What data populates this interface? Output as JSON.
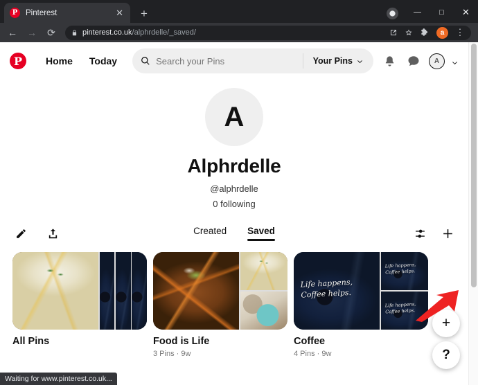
{
  "browser": {
    "tab": {
      "title": "Pinterest",
      "favicon": "pinterest-icon",
      "close": "✕"
    },
    "new_tab_label": "+",
    "window_controls": {
      "minimize": "—",
      "maximize": "□",
      "close": "✕"
    },
    "nav": {
      "back": "←",
      "forward": "→",
      "reload": "⟳"
    },
    "omnibox": {
      "lock_icon": "lock-icon",
      "url_domain": "pinterest.co.uk",
      "url_path": "/alphrdelle/_saved/",
      "install_icon": "install-icon",
      "bookmark_icon": "star-icon",
      "extensions_icon": "puzzle-icon",
      "profile_initial": "a",
      "menu_icon": "⋮"
    },
    "status_text": "Waiting for www.pinterest.co.uk..."
  },
  "header": {
    "logo": "pinterest-logo",
    "logo_letter": "P",
    "home_label": "Home",
    "today_label": "Today",
    "search_placeholder": "Search your Pins",
    "search_value": "",
    "your_pins_label": "Your Pins",
    "notifications_icon": "bell-icon",
    "messages_icon": "chat-icon",
    "account_initial": "A",
    "account_chevron": "chevron-down-icon"
  },
  "profile": {
    "avatar_initial": "A",
    "name": "Alphrdelle",
    "handle": "@alphrdelle",
    "following": "0 following"
  },
  "actions": {
    "edit_icon": "pencil-icon",
    "share_icon": "share-icon",
    "sort_icon": "sliders-icon",
    "add_icon": "plus-icon"
  },
  "tabs": [
    {
      "label": "Created",
      "active": false
    },
    {
      "label": "Saved",
      "active": true
    }
  ],
  "boards": [
    {
      "title": "All Pins",
      "meta": ""
    },
    {
      "title": "Food is Life",
      "meta": "3 Pins · 9w"
    },
    {
      "title": "Coffee",
      "meta": "4 Pins · 9w"
    }
  ],
  "coffee_overlay_text": "Life happens,\nCoffee helps.",
  "fab": {
    "create_label": "+",
    "help_label": "?"
  },
  "annotation": {
    "arrow_color": "#ee2222",
    "points_to": "add-board-button"
  },
  "colors": {
    "brand_red": "#e60023",
    "annotation_red": "#ee2222",
    "chrome_dark": "#202124",
    "chrome_toolbar": "#35363a"
  }
}
